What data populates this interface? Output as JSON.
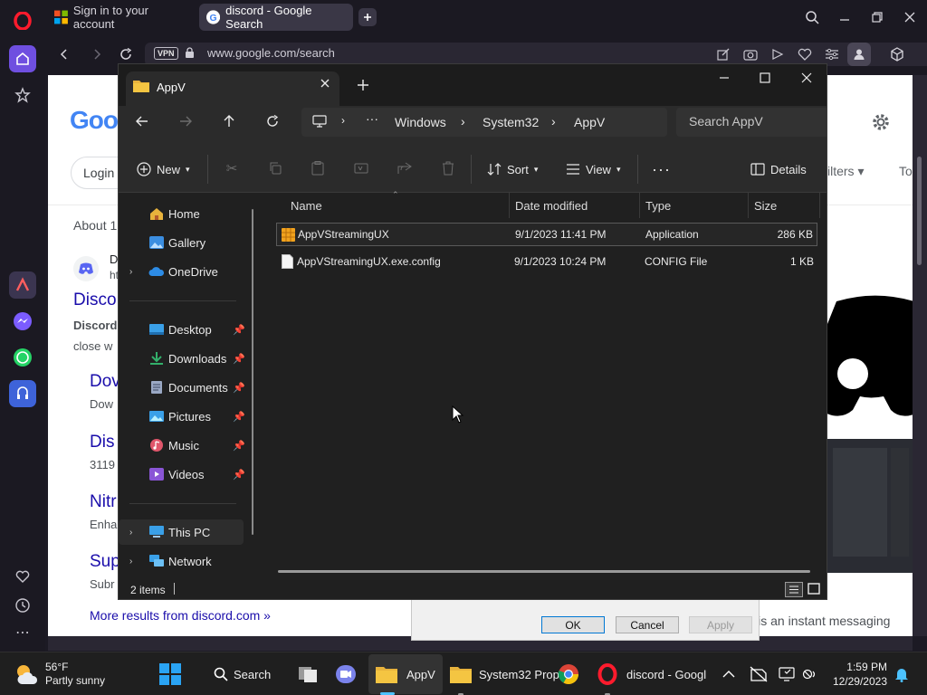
{
  "browser": {
    "tabs": [
      {
        "label": "Sign in to your account"
      },
      {
        "label": "discord - Google Search"
      }
    ],
    "url": "www.google.com/search",
    "vpn_label": "VPN"
  },
  "google": {
    "logo": "Goog",
    "login_label": "Login",
    "filters_label": "ilters",
    "tools_label": "To",
    "about": "About 1",
    "site_letter": "D",
    "site_url": "ht",
    "result_title": "Disco",
    "result_desc_bold": "Discord",
    "result_desc": "close w",
    "sub": [
      {
        "title": "Dov",
        "desc": "Dow"
      },
      {
        "title": "Dis",
        "desc": "3119"
      },
      {
        "title": "Nitr",
        "desc": "Enha"
      },
      {
        "title": "Sup",
        "desc": "Subr"
      }
    ],
    "more_results": "More results from discord.com »",
    "snippet_right": "ord is an instant messaging"
  },
  "dialog_behind": {
    "ok": "OK",
    "cancel": "Cancel",
    "apply": "Apply"
  },
  "explorer": {
    "tab_title": "AppV",
    "breadcrumb": [
      "Windows",
      "System32",
      "AppV"
    ],
    "search_placeholder": "Search AppV",
    "commands": {
      "new": "New",
      "sort": "Sort",
      "view": "View",
      "details": "Details"
    },
    "nav": {
      "home": "Home",
      "gallery": "Gallery",
      "onedrive": "OneDrive",
      "desktop": "Desktop",
      "downloads": "Downloads",
      "documents": "Documents",
      "pictures": "Pictures",
      "music": "Music",
      "videos": "Videos",
      "this_pc": "This PC",
      "network": "Network"
    },
    "columns": {
      "name": "Name",
      "date": "Date modified",
      "type": "Type",
      "size": "Size"
    },
    "files": [
      {
        "name": "AppVStreamingUX",
        "date": "9/1/2023 11:41 PM",
        "type": "Application",
        "size": "286 KB"
      },
      {
        "name": "AppVStreamingUX.exe.config",
        "date": "9/1/2023 10:24 PM",
        "type": "CONFIG File",
        "size": "1 KB"
      }
    ],
    "status": "2 items"
  },
  "taskbar": {
    "weather_temp": "56°F",
    "weather_desc": "Partly sunny",
    "search": "Search",
    "apps": [
      {
        "label": "AppV"
      },
      {
        "label": "System32 Prop"
      },
      {
        "label": "discord - Googl"
      }
    ],
    "time": "1:59 PM",
    "date": "12/29/2023"
  },
  "colors": {
    "opera_accent": "#6f4fe0",
    "google_link": "#1a0dab",
    "explorer_bg": "#202020",
    "folder_yellow": "#f4c542"
  }
}
